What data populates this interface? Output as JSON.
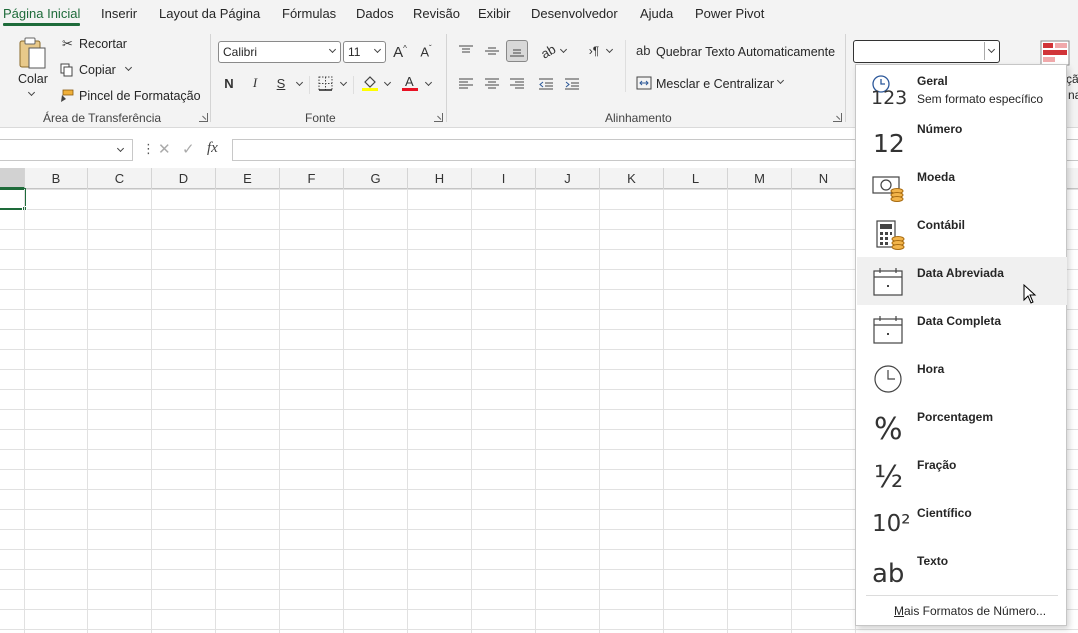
{
  "tabs": [
    "Página Inicial",
    "Inserir",
    "Layout da Página",
    "Fórmulas",
    "Dados",
    "Revisão",
    "Exibir",
    "Desenvolvedor",
    "Ajuda",
    "Power Pivot"
  ],
  "clipboard": {
    "paste_label": "Colar",
    "cut_label": "Recortar",
    "copy_label": "Copiar",
    "format_painter_label": "Pincel de Formatação",
    "group_label": "Área de Transferência"
  },
  "font": {
    "font_name": "Calibri",
    "font_size": "11",
    "bold_label": "N",
    "italic_label": "I",
    "underline_label": "S",
    "group_label": "Fonte",
    "highlight_color": "#ffff00",
    "font_color": "#e81123"
  },
  "alignment": {
    "wrap_text_label": "Quebrar Texto Automaticamente",
    "merge_center_label": "Mesclar e Centralizar",
    "group_label": "Alinhamento"
  },
  "formula_bar": {
    "fx_label": "fx"
  },
  "columns": [
    "B",
    "C",
    "D",
    "E",
    "F",
    "G",
    "H",
    "I",
    "J",
    "K",
    "L",
    "M",
    "N"
  ],
  "number_format_menu": {
    "items": [
      {
        "label": "Geral",
        "sub": "Sem formato específico",
        "icon": "general-clock-123-icon",
        "glyph": "123"
      },
      {
        "label": "Número",
        "sub": "",
        "icon": "number-12-icon",
        "glyph": "12"
      },
      {
        "label": "Moeda",
        "sub": "",
        "icon": "currency-bill-icon",
        "glyph": ""
      },
      {
        "label": "Contábil",
        "sub": "",
        "icon": "accounting-calculator-icon",
        "glyph": ""
      },
      {
        "label": "Data Abreviada",
        "sub": "",
        "icon": "calendar-icon",
        "glyph": ""
      },
      {
        "label": "Data Completa",
        "sub": "",
        "icon": "calendar-icon",
        "glyph": ""
      },
      {
        "label": "Hora",
        "sub": "",
        "icon": "clock-icon",
        "glyph": ""
      },
      {
        "label": "Porcentagem",
        "sub": "",
        "icon": "percent-icon",
        "glyph": "%"
      },
      {
        "label": "Fração",
        "sub": "",
        "icon": "fraction-icon",
        "glyph": "½"
      },
      {
        "label": "Científico",
        "sub": "",
        "icon": "scientific-icon",
        "glyph": "10²"
      },
      {
        "label": "Texto",
        "sub": "",
        "icon": "text-ab-icon",
        "glyph": "ab"
      }
    ],
    "more_label_first": "M",
    "more_label_rest": "ais Formatos de Número..."
  },
  "partial_right_text": [
    "çã",
    "na"
  ],
  "accent_color": "#1e6b3a"
}
